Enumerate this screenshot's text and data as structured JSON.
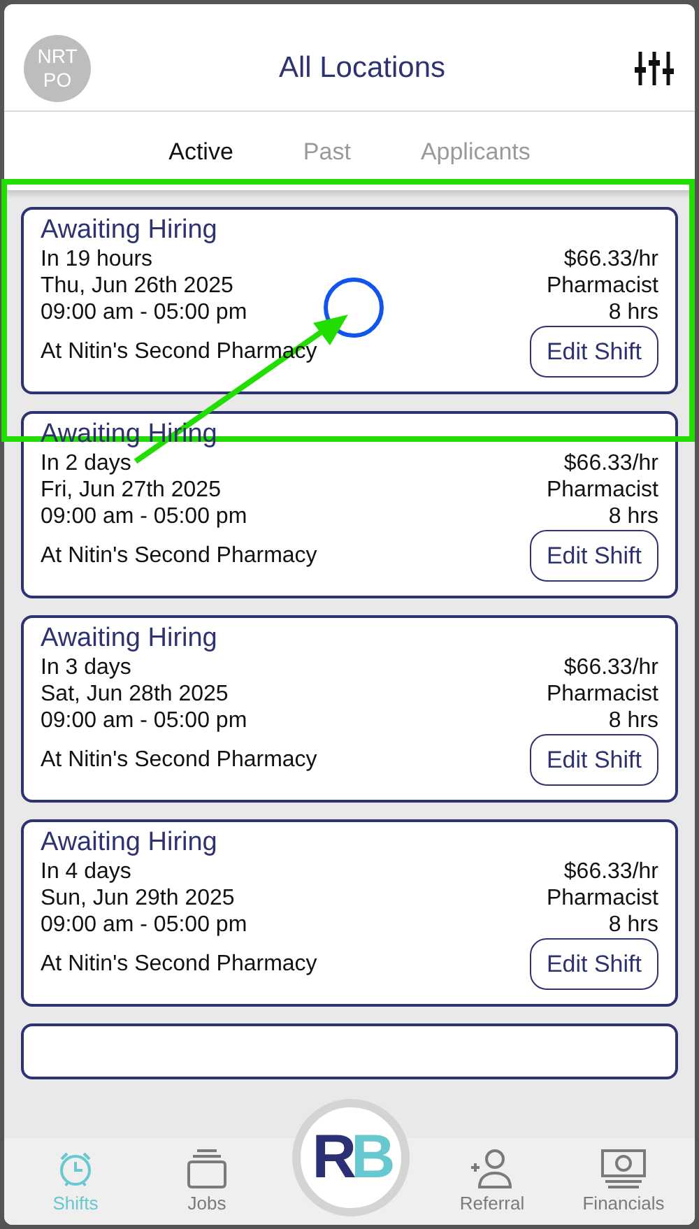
{
  "header": {
    "avatar": "NRT PO",
    "title": "All Locations"
  },
  "tabs": [
    {
      "label": "Active",
      "selected": true
    },
    {
      "label": "Past",
      "selected": false
    },
    {
      "label": "Applicants",
      "selected": false
    }
  ],
  "shifts": [
    {
      "status": "Awaiting Hiring",
      "relative": "In 19 hours",
      "date": "Thu, Jun 26th 2025",
      "time": "09:00 am - 05:00 pm",
      "location": "At Nitin's Second Pharmacy",
      "rate": "$66.33/hr",
      "role": "Pharmacist",
      "duration": "8 hrs",
      "action": "Edit Shift"
    },
    {
      "status": "Awaiting Hiring",
      "relative": "In 2 days",
      "date": "Fri, Jun 27th 2025",
      "time": "09:00 am - 05:00 pm",
      "location": "At Nitin's Second Pharmacy",
      "rate": "$66.33/hr",
      "role": "Pharmacist",
      "duration": "8 hrs",
      "action": "Edit Shift"
    },
    {
      "status": "Awaiting Hiring",
      "relative": "In 3 days",
      "date": "Sat, Jun 28th 2025",
      "time": "09:00 am - 05:00 pm",
      "location": "At Nitin's Second Pharmacy",
      "rate": "$66.33/hr",
      "role": "Pharmacist",
      "duration": "8 hrs",
      "action": "Edit Shift"
    },
    {
      "status": "Awaiting Hiring",
      "relative": "In 4 days",
      "date": "Sun, Jun 29th 2025",
      "time": "09:00 am - 05:00 pm",
      "location": "At Nitin's Second Pharmacy",
      "rate": "$66.33/hr",
      "role": "Pharmacist",
      "duration": "8 hrs",
      "action": "Edit Shift"
    }
  ],
  "nav": [
    {
      "label": "Shifts",
      "kind": "clock",
      "selected": true
    },
    {
      "label": "Jobs",
      "kind": "stack",
      "selected": false
    },
    {
      "label": "Referral",
      "kind": "person",
      "selected": false
    },
    {
      "label": "Financials",
      "kind": "money",
      "selected": false
    }
  ],
  "logo": {
    "left": "R",
    "right": "B"
  }
}
